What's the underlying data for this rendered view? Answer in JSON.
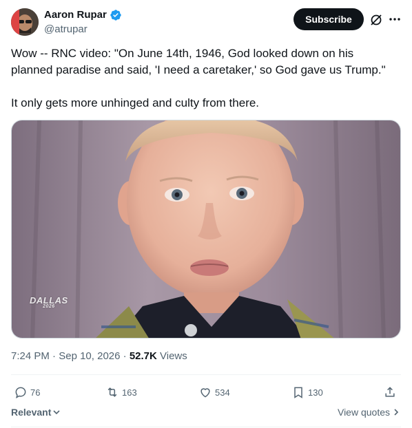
{
  "author": {
    "display_name": "Aaron Rupar",
    "handle": "@atrupar",
    "verified": true
  },
  "header": {
    "subscribe_label": "Subscribe",
    "icons": [
      "grok-icon",
      "more-icon"
    ]
  },
  "tweet": {
    "paragraphs": [
      "Wow -- RNC video: \"On June 14th, 1946, God looked down on his planned paradise and said, 'I need a caretaker,' so God gave us Trump.\"",
      "It only gets more unhinged and culty from there."
    ]
  },
  "media": {
    "watermark": "DALLAS",
    "watermark_sub": "2026"
  },
  "meta": {
    "time": "7:24 PM",
    "separator": "·",
    "date": "Sep 10, 2026",
    "views_count": "52.7K",
    "views_label": "Views"
  },
  "actions": {
    "replies": "76",
    "retweets": "163",
    "likes": "534",
    "bookmarks": "130"
  },
  "footer": {
    "sort_label": "Relevant",
    "view_quotes_label": "View quotes"
  },
  "colors": {
    "text_primary": "#0f1419",
    "text_secondary": "#536471",
    "verified_blue": "#1d9bf0",
    "divider": "#eff3f4"
  }
}
